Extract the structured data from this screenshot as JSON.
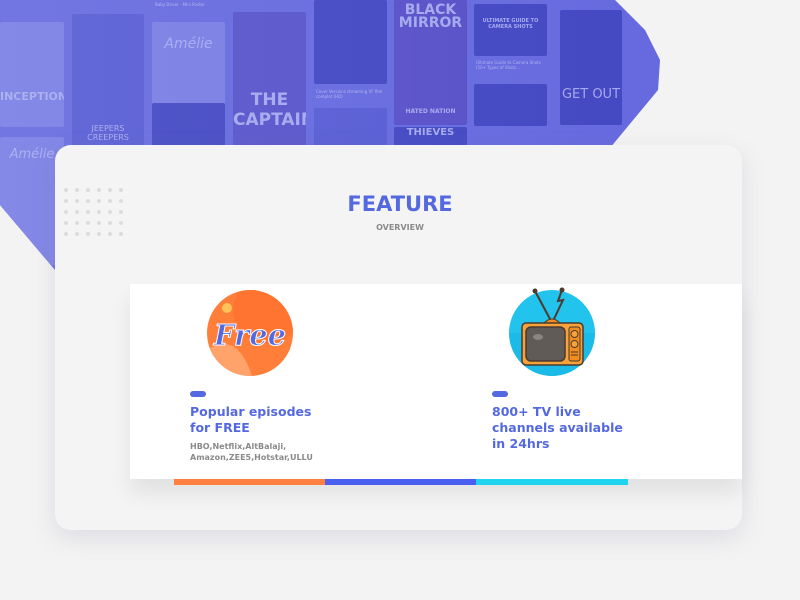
{
  "background": {
    "posters": [
      "INCEPTION",
      "Amélie",
      "THE CAPTAIN",
      "BLACK MIRROR",
      "HATED NATION",
      "GET OUT",
      "THIEVES",
      "JEEPERS CREEPERS",
      "Amélie",
      "ULTIMATE GUIDE TO CAMERA SHOTS"
    ],
    "captions": [
      "Baby Driver - Mini Poster",
      "Cover Versions streaming VF film complet (HD)",
      "Ultimate Guide to Camera Shots (50+ Types of Shots...",
      "Ultimate Guide to Camera Shots (50+ Types of Shots..."
    ],
    "overlay_color": "#6f73e0"
  },
  "section": {
    "title": "FEATURE",
    "subtitle": "OVERVIEW"
  },
  "features": [
    {
      "icon": "free-badge-icon",
      "badge_text": "Free",
      "title_line1": "Popular episodes",
      "title_line2": "for FREE",
      "desc_line1": "HBO,Netflix,AltBalaji,",
      "desc_line2": "Amazon,ZEE5,Hotstar,ULLU"
    },
    {
      "icon": "tv-icon",
      "title_line1": "800+ TV live",
      "title_line2": "channels available",
      "title_line3": "in 24hrs"
    }
  ],
  "colors": {
    "accent": "#5469e0",
    "orange": "#ff8040",
    "blue": "#4a5ff0",
    "cyan": "#1ed4ee"
  }
}
